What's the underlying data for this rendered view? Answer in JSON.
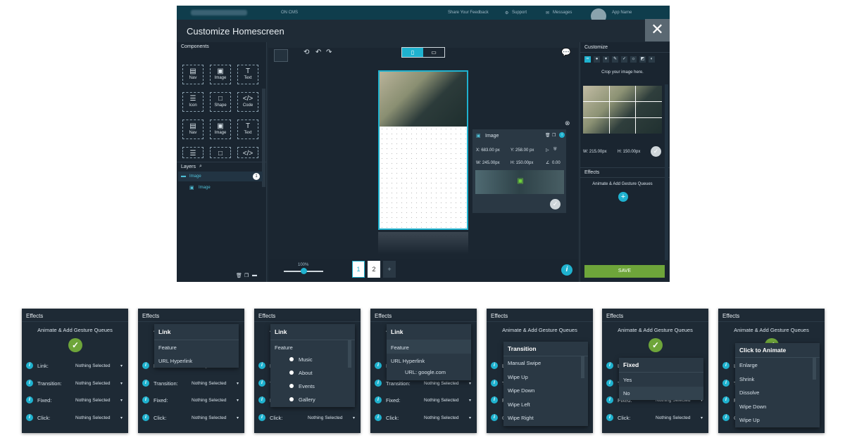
{
  "header": {
    "share_feedback": "Share Your Feedback",
    "support": "Support",
    "messages": "Messages",
    "user_name": "App Name",
    "left_tag": "ON CMS"
  },
  "modal": {
    "title": "Customize Homescreen",
    "close": "✕"
  },
  "components": {
    "title": "Components",
    "items": [
      {
        "icon": "▤",
        "label": "Nav"
      },
      {
        "icon": "▣",
        "label": "Image"
      },
      {
        "icon": "T",
        "label": "Text"
      },
      {
        "icon": "☰",
        "label": "Icon"
      },
      {
        "icon": "□",
        "label": "Shape"
      },
      {
        "icon": "</>",
        "label": "Code"
      },
      {
        "icon": "▤",
        "label": "Nav"
      },
      {
        "icon": "▣",
        "label": "Image"
      },
      {
        "icon": "T",
        "label": "Text"
      },
      {
        "icon": "☰",
        "label": ""
      },
      {
        "icon": "□",
        "label": ""
      },
      {
        "icon": "</>",
        "label": ""
      }
    ]
  },
  "layers": {
    "title": "Layers",
    "items": [
      "Image",
      "Image"
    ],
    "badge": "1"
  },
  "image_popover": {
    "title": "Image",
    "x": "X: 683.00 px",
    "y": "Y: 258.00 px",
    "w": "W: 245.00px",
    "h": "H: 150.00px",
    "angle": "0.00"
  },
  "zoom": {
    "label": "100%",
    "value": 0.5
  },
  "pages": [
    "1",
    "2",
    "+"
  ],
  "customize": {
    "title": "Customize",
    "crop_hint": "Crop your image here.",
    "w": "W: 215.00px",
    "h": "H: 150.00px",
    "effects_title": "Effects",
    "effects_sub": "Animate & Add Gesture Queues",
    "save": "SAVE"
  },
  "cards": {
    "header": "Effects",
    "subtitle": "Animate & Add Gesture Queues",
    "rows": [
      "Link:",
      "Transition:",
      "Fixed:",
      "Click:"
    ],
    "value": "Nothing Selected",
    "card2": {
      "title": "Link",
      "items": [
        "Feature",
        "URL Hyperlink"
      ]
    },
    "card3": {
      "title": "Link",
      "feature": "Feature",
      "options": [
        "Music",
        "About",
        "Events",
        "Gallery"
      ]
    },
    "card4": {
      "title": "Link",
      "items": [
        "Feature",
        "URL Hyperlink"
      ],
      "url": "URL: google.com"
    },
    "card5": {
      "title": "Transition",
      "items": [
        "Manual Swipe",
        "Wipe Up",
        "Wipe Down",
        "Wipe Left",
        "Wipe Right"
      ]
    },
    "card6": {
      "title": "Fixed",
      "items": [
        "Yes",
        "No"
      ]
    },
    "card7": {
      "title": "Click to Animate",
      "items": [
        "Enlarge",
        "Shrink",
        "Dissolve",
        "Wipe Down",
        "Wipe Up"
      ]
    }
  },
  "colors": {
    "accent": "#1fb2cf",
    "save": "#6ea53a",
    "panel": "#1f2b36"
  }
}
